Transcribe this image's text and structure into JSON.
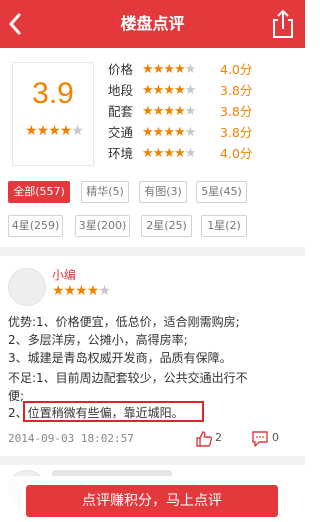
{
  "header": {
    "title": "楼盘点评",
    "back_icon": "chevron-left-icon",
    "share_icon": "share-icon",
    "bg_color": "#e4393c"
  },
  "summary": {
    "overall_score": "3.9",
    "overall_stars": 4,
    "ratings": [
      {
        "label": "价格",
        "stars": 4,
        "value": "4.0分"
      },
      {
        "label": "地段",
        "stars": 4,
        "value": "3.8分"
      },
      {
        "label": "配套",
        "stars": 4,
        "value": "3.8分"
      },
      {
        "label": "交通",
        "stars": 4,
        "value": "3.8分"
      },
      {
        "label": "环境",
        "stars": 4,
        "value": "4.0分"
      }
    ]
  },
  "filters": [
    {
      "label": "全部(557)",
      "active": true
    },
    {
      "label": "精华(5)",
      "active": false
    },
    {
      "label": "有图(3)",
      "active": false
    },
    {
      "label": "5星(45)",
      "active": false
    },
    {
      "label": "4星(259)",
      "active": false
    },
    {
      "label": "3星(200)",
      "active": false
    },
    {
      "label": "2星(25)",
      "active": false
    },
    {
      "label": "1星(2)",
      "active": false
    }
  ],
  "review": {
    "author": "小编",
    "stars": 4,
    "pros_line1": "优势:1、价格便宜，低总价，适合刚需购房;",
    "pros_line2": "2、多层洋房，公摊小，高得房率;",
    "pros_line3": "3、城建是青岛权威开发商，品质有保障。",
    "cons_line1": "不足:1、目前周边配套较少，公共交通出行不",
    "cons_line2": "便;",
    "cons_line3_prefix": "2、",
    "cons_line3_highlight": "位置稍微有些偏，靠近城阳。",
    "date": "2014-09-03 18:02:57",
    "likes": "2",
    "comments": "0"
  },
  "cta": {
    "label": "点评赚积分，马上点评"
  },
  "colors": {
    "accent": "#e4393c",
    "star": "#f08200",
    "star_empty": "#c8c8c8"
  }
}
